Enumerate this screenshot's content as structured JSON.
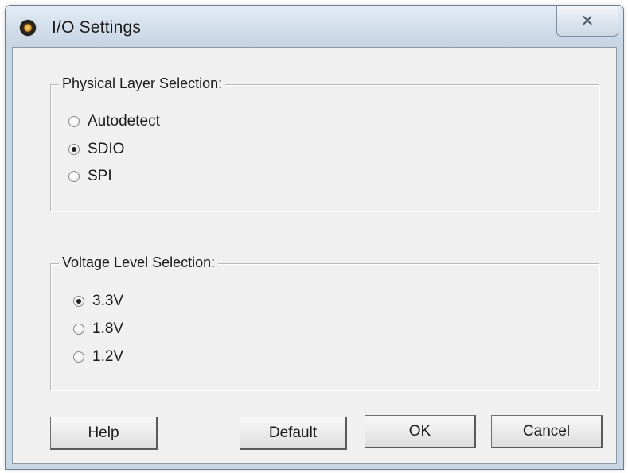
{
  "window": {
    "title": "I/O Settings",
    "close_glyph": "✕"
  },
  "physical_layer": {
    "legend": "Physical Layer Selection:",
    "options": [
      {
        "label": "Autodetect",
        "checked": false
      },
      {
        "label": "SDIO",
        "checked": true
      },
      {
        "label": "SPI",
        "checked": false
      }
    ]
  },
  "voltage_level": {
    "legend": "Voltage Level Selection:",
    "options": [
      {
        "label": "3.3V",
        "checked": true
      },
      {
        "label": "1.8V",
        "checked": false
      },
      {
        "label": "1.2V",
        "checked": false
      }
    ]
  },
  "buttons": {
    "help": "Help",
    "default": "Default",
    "ok": "OK",
    "cancel": "Cancel"
  },
  "icons": {
    "app": "app-icon",
    "close": "close-icon"
  }
}
